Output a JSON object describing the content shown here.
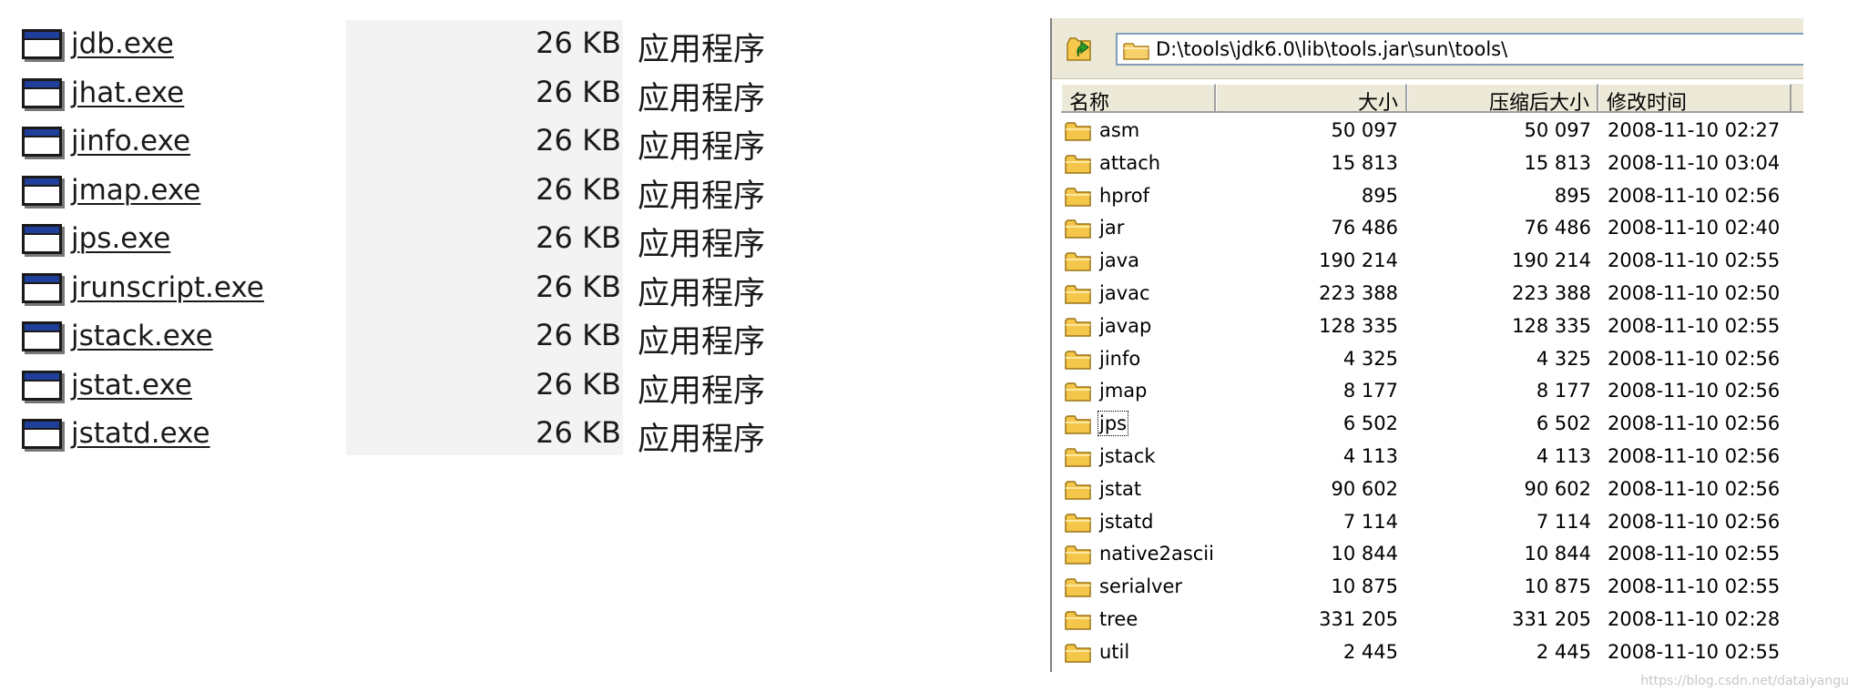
{
  "left_list": {
    "items": [
      {
        "name": "jdb.exe",
        "size": "26 KB",
        "type": "应用程序",
        "icon": "exe-window-icon"
      },
      {
        "name": "jhat.exe",
        "size": "26 KB",
        "type": "应用程序",
        "icon": "exe-window-icon"
      },
      {
        "name": "jinfo.exe",
        "size": "26 KB",
        "type": "应用程序",
        "icon": "exe-window-icon"
      },
      {
        "name": "jmap.exe",
        "size": "26 KB",
        "type": "应用程序",
        "icon": "exe-window-icon"
      },
      {
        "name": "jps.exe",
        "size": "26 KB",
        "type": "应用程序",
        "icon": "exe-window-icon"
      },
      {
        "name": "jrunscript.exe",
        "size": "26 KB",
        "type": "应用程序",
        "icon": "exe-window-icon"
      },
      {
        "name": "jstack.exe",
        "size": "26 KB",
        "type": "应用程序",
        "icon": "exe-window-icon"
      },
      {
        "name": "jstat.exe",
        "size": "26 KB",
        "type": "应用程序",
        "icon": "exe-window-icon"
      },
      {
        "name": "jstatd.exe",
        "size": "26 KB",
        "type": "应用程序",
        "icon": "exe-window-icon"
      }
    ]
  },
  "archive_window": {
    "up_button_icon": "up-folder-icon",
    "path": "D:\\tools\\jdk6.0\\lib\\tools.jar\\sun\\tools\\",
    "columns": {
      "name": "名称",
      "size": "大小",
      "packed": "压缩后大小",
      "modified": "修改时间"
    },
    "rows": [
      {
        "name": "asm",
        "size": "50 097",
        "packed": "50 097",
        "modified": "2008-11-10 02:27"
      },
      {
        "name": "attach",
        "size": "15 813",
        "packed": "15 813",
        "modified": "2008-11-10 03:04"
      },
      {
        "name": "hprof",
        "size": "895",
        "packed": "895",
        "modified": "2008-11-10 02:56"
      },
      {
        "name": "jar",
        "size": "76 486",
        "packed": "76 486",
        "modified": "2008-11-10 02:40"
      },
      {
        "name": "java",
        "size": "190 214",
        "packed": "190 214",
        "modified": "2008-11-10 02:55"
      },
      {
        "name": "javac",
        "size": "223 388",
        "packed": "223 388",
        "modified": "2008-11-10 02:50"
      },
      {
        "name": "javap",
        "size": "128 335",
        "packed": "128 335",
        "modified": "2008-11-10 02:55"
      },
      {
        "name": "jinfo",
        "size": "4 325",
        "packed": "4 325",
        "modified": "2008-11-10 02:56"
      },
      {
        "name": "jmap",
        "size": "8 177",
        "packed": "8 177",
        "modified": "2008-11-10 02:56"
      },
      {
        "name": "jps",
        "size": "6 502",
        "packed": "6 502",
        "modified": "2008-11-10 02:56",
        "focused": true
      },
      {
        "name": "jstack",
        "size": "4 113",
        "packed": "4 113",
        "modified": "2008-11-10 02:56"
      },
      {
        "name": "jstat",
        "size": "90 602",
        "packed": "90 602",
        "modified": "2008-11-10 02:56"
      },
      {
        "name": "jstatd",
        "size": "7 114",
        "packed": "7 114",
        "modified": "2008-11-10 02:56"
      },
      {
        "name": "native2ascii",
        "size": "10 844",
        "packed": "10 844",
        "modified": "2008-11-10 02:55"
      },
      {
        "name": "serialver",
        "size": "10 875",
        "packed": "10 875",
        "modified": "2008-11-10 02:55"
      },
      {
        "name": "tree",
        "size": "331 205",
        "packed": "331 205",
        "modified": "2008-11-10 02:28"
      },
      {
        "name": "util",
        "size": "2 445",
        "packed": "2 445",
        "modified": "2008-11-10 02:55"
      }
    ]
  },
  "watermark": "https://blog.csdn.net/dataiyangu"
}
